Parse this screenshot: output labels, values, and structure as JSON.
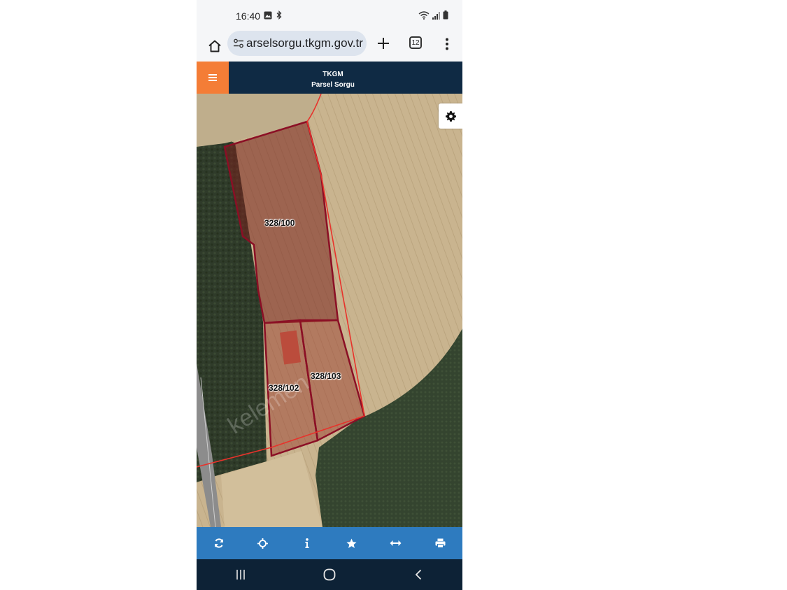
{
  "status_bar": {
    "time": "16:40",
    "left_icons": [
      "image-icon",
      "bluetooth-icon"
    ],
    "right_icons": [
      "wifi-icon",
      "signal-icon",
      "battery-icon"
    ]
  },
  "browser": {
    "url": "arselsorgu.tkgm.gov.tr",
    "tab_count": "12",
    "icons": [
      "home-icon",
      "tune-icon",
      "plus-icon",
      "tabs-icon",
      "more-vert-icon"
    ]
  },
  "app_header": {
    "title_line1": "TKGM",
    "title_line2": "Parsel Sorgu",
    "menu_icon": "hamburger-icon",
    "accent_color": "#f47d36",
    "header_color": "#0f2a44"
  },
  "map": {
    "settings_icon": "gear-icon",
    "watermark": "kelemen",
    "parcels": [
      {
        "label": "328/100"
      },
      {
        "label": "328/102"
      },
      {
        "label": "328/103"
      }
    ],
    "parcel_stroke_color": "#8b0f25",
    "boundary_line_color": "#e8322b"
  },
  "toolbar": {
    "color": "#2e7bbf",
    "tools": [
      {
        "icon": "refresh-icon"
      },
      {
        "icon": "crosshair-icon"
      },
      {
        "icon": "info-icon"
      },
      {
        "icon": "star-icon"
      },
      {
        "icon": "measure-icon"
      },
      {
        "icon": "print-icon"
      }
    ]
  },
  "nav_bar": {
    "buttons": [
      "recent-apps-icon",
      "home-circle-icon",
      "back-icon"
    ]
  }
}
